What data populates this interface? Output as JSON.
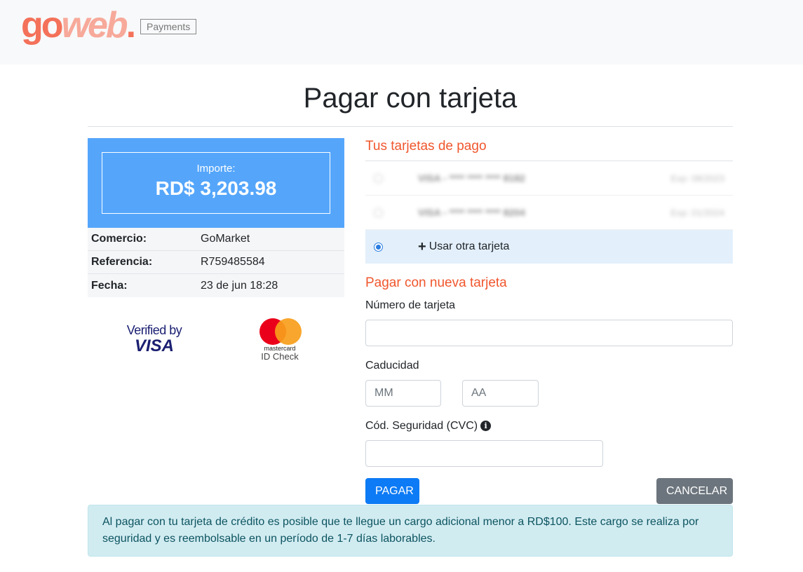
{
  "header": {
    "logo_go": "go",
    "logo_web": "web",
    "logo_dot": ".",
    "badge": "Payments"
  },
  "page_title": "Pagar con tarjeta",
  "summary": {
    "amount_label": "Importe:",
    "amount_value": "RD$ 3,203.98",
    "rows": [
      {
        "key": "Comercio:",
        "value": "GoMarket"
      },
      {
        "key": "Referencia:",
        "value": "R759485584"
      },
      {
        "key": "Fecha:",
        "value": "23 de jun 18:28"
      }
    ]
  },
  "logos": {
    "visa_line1": "Verified by",
    "visa_line2": "VISA",
    "mastercard_brand": "mastercard",
    "mastercard_id": "ID Check"
  },
  "saved_cards": {
    "heading": "Tus tarjetas de pago",
    "cards": [
      {
        "mask": "VISA - **** **** **** 8182",
        "exp": "Exp: 08/2023"
      },
      {
        "mask": "VISA - **** **** **** 8204",
        "exp": "Exp: 01/2024"
      }
    ],
    "other_card_label": "Usar otra tarjeta"
  },
  "new_card": {
    "heading": "Pagar con nueva tarjeta",
    "card_number_label": "Número de tarjeta",
    "card_number_value": "",
    "expiry_label": "Caducidad",
    "month_placeholder": "MM",
    "year_placeholder": "AA",
    "cvc_label": "Cód. Seguridad (CVC)",
    "cvc_value": ""
  },
  "actions": {
    "pay_label": "PAGAR",
    "cancel_label": "CANCELAR"
  },
  "notice": "Al pagar con tu tarjeta de crédito es posible que te llegue un cargo adicional menor a RD$100. Este cargo se realiza por seguridad y es reembolsable en un período de 1-7 días laborables.",
  "colors": {
    "brand": "#f4715a",
    "accent_blue": "#55a6fb",
    "heading_orange": "#f0562d",
    "primary_button": "#0d7bf5",
    "secondary_button": "#6c757d",
    "alert_bg": "#d1ecf1"
  }
}
